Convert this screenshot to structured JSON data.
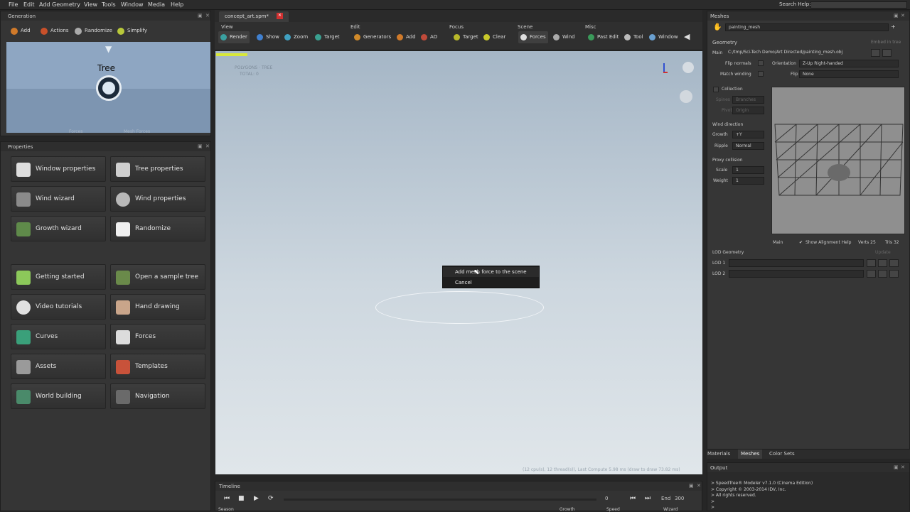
{
  "menu": [
    "File",
    "Edit",
    "Add Geometry",
    "View",
    "Tools",
    "Window",
    "Media",
    "Help"
  ],
  "search_help_label": "Search Help:",
  "generation": {
    "title": "Generation",
    "buttons": [
      "Add",
      "Actions",
      "Randomize",
      "Simplify"
    ],
    "tree_label": "Tree",
    "node_labels": [
      "Forces",
      "Mesh Forces"
    ]
  },
  "properties": {
    "title": "Properties",
    "items": [
      {
        "label": "Window properties",
        "icon": "window-icon"
      },
      {
        "label": "Tree properties",
        "icon": "tree-icon"
      },
      {
        "label": "Wind wizard",
        "icon": "wind-wizard-icon"
      },
      {
        "label": "Wind properties",
        "icon": "fan-icon"
      },
      {
        "label": "Growth wizard",
        "icon": "growth-wizard-icon"
      },
      {
        "label": "Randomize",
        "icon": "dice-icon"
      },
      {
        "label": "Getting started",
        "icon": "getting-started-icon"
      },
      {
        "label": "Open a sample tree",
        "icon": "sample-tree-icon"
      },
      {
        "label": "Video tutorials",
        "icon": "play-icon"
      },
      {
        "label": "Hand drawing",
        "icon": "hand-icon"
      },
      {
        "label": "Curves",
        "icon": "curves-icon"
      },
      {
        "label": "Forces",
        "icon": "magnet-icon"
      },
      {
        "label": "Assets",
        "icon": "assets-icon"
      },
      {
        "label": "Templates",
        "icon": "templates-icon"
      },
      {
        "label": "World building",
        "icon": "world-icon"
      },
      {
        "label": "Navigation",
        "icon": "navigation-icon"
      }
    ]
  },
  "document_tab": "concept_art.spm*",
  "toolbar": {
    "groups": [
      "View",
      "Edit",
      "Focus",
      "Scene",
      "Misc"
    ],
    "view": [
      "Render",
      "Show",
      "Zoom",
      "Target"
    ],
    "edit": [
      "Generators",
      "Add",
      "AO"
    ],
    "focus": [
      "Target",
      "Clear"
    ],
    "scene": [
      "Forces",
      "Wind"
    ],
    "misc": [
      "Past Edit",
      "Tool",
      "Window"
    ]
  },
  "viewport": {
    "stats_line1": "POLYGONS · TREE",
    "stats_line2": "TOTAL: 0",
    "footer": "(12 cpu(s), 12 thread(s)), Last Compute 5.98 ms (draw to draw 73.82 ms)",
    "context_menu": [
      "Add mesh force to the scene",
      "Cancel"
    ]
  },
  "timeline": {
    "title": "Timeline",
    "frame": "0",
    "end_label": "End",
    "end_value": "300",
    "season_label": "Season",
    "growth_label": "Growth",
    "speed_label": "Speed",
    "wizard_label": "Wizard"
  },
  "meshes": {
    "title": "Meshes",
    "mesh_name": "painting_mesh",
    "geometry_label": "Geometry",
    "main_label": "Main",
    "main_path": "C:/tmp/Sci-Tech Demo/Art Directed/painting_mesh.obj",
    "embed_label": "Embed in tree",
    "flip_normals_label": "Flip normals",
    "orientation_label": "Orientation",
    "orientation_value": "Z-Up Right-handed",
    "match_winding_label": "Match winding",
    "flip_label": "Flip",
    "flip_value": "None",
    "collection_label": "Collection",
    "spines_label": "Spines",
    "spines_value": "Branches",
    "pivot_label": "Pivot",
    "pivot_value": "Origin",
    "wind_direction_label": "Wind direction",
    "growth_label": "Growth",
    "growth_value": "+Y",
    "ripple_label": "Ripple",
    "ripple_value": "Normal",
    "proxy_label": "Proxy collision",
    "scale_label": "Scale",
    "scale_value": "1",
    "weight_label": "Weight",
    "weight_value": "1",
    "preview_main": "Main",
    "show_alignment": "Show Alignment Help",
    "verts": "Verts 25",
    "tris": "Tris 32",
    "lod_geometry_label": "LOD Geometry",
    "lod_update": "Update",
    "lods": [
      "LOD 1",
      "LOD 2"
    ]
  },
  "bottom_tabs": [
    "Materials",
    "Meshes",
    "Color Sets"
  ],
  "output": {
    "title": "Output",
    "lines": [
      "> SpeedTree® Modeler v7.1.0 (Cinema Edition)",
      "> Copyright © 2003-2014 IDV, Inc.",
      "> All rights reserved.",
      ">",
      ">"
    ]
  }
}
